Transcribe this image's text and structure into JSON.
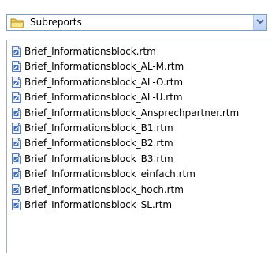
{
  "folder_select": {
    "selected": "Subreports",
    "icon": "folder-icon"
  },
  "files": [
    {
      "name": "Brief_Informationsblock.rtm",
      "icon": "report-file-icon"
    },
    {
      "name": "Brief_Informationsblock_AL-M.rtm",
      "icon": "report-file-icon"
    },
    {
      "name": "Brief_Informationsblock_AL-O.rtm",
      "icon": "report-file-icon"
    },
    {
      "name": "Brief_Informationsblock_AL-U.rtm",
      "icon": "report-file-icon"
    },
    {
      "name": "Brief_Informationsblock_Ansprechpartner.rtm",
      "icon": "report-file-icon"
    },
    {
      "name": "Brief_Informationsblock_B1.rtm",
      "icon": "report-file-icon"
    },
    {
      "name": "Brief_Informationsblock_B2.rtm",
      "icon": "report-file-icon"
    },
    {
      "name": "Brief_Informationsblock_B3.rtm",
      "icon": "report-file-icon"
    },
    {
      "name": "Brief_Informationsblock_einfach.rtm",
      "icon": "report-file-icon"
    },
    {
      "name": "Brief_Informationsblock_hoch.rtm",
      "icon": "report-file-icon"
    },
    {
      "name": "Brief_Informationsblock_SL.rtm",
      "icon": "report-file-icon"
    }
  ],
  "colors": {
    "folder": "#f3d35b",
    "combo_border": "#7f9db9",
    "file_icon_blue": "#3a6ec2"
  }
}
